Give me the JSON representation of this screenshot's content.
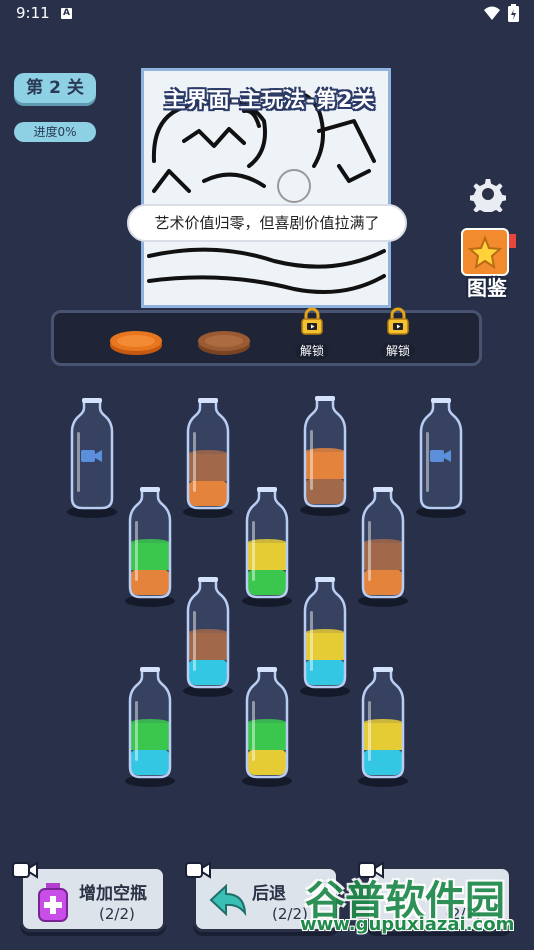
{
  "status_bar": {
    "time": "9:11",
    "notification_icon": "A",
    "icons": [
      "wifi-icon",
      "battery-icon"
    ]
  },
  "level": {
    "label": "第 2 关",
    "progress": "进度0%"
  },
  "picture": {
    "title": "主界面-主玩法-第2关",
    "speech": "艺术价值归零，但喜剧价值拉满了"
  },
  "sidebar": {
    "collection_label": "图鉴"
  },
  "shelf": {
    "slots": [
      {
        "type": "plate",
        "color": "#e8761f"
      },
      {
        "type": "plate",
        "color": "#9a5b32"
      },
      {
        "type": "locked",
        "label": "解锁"
      },
      {
        "type": "locked",
        "label": "解锁"
      }
    ]
  },
  "colors": {
    "orange": "#f07c22",
    "brown": "#a35e32",
    "green": "#2fc936",
    "yellow": "#f2ce19",
    "cyan": "#27c9e0"
  },
  "bottles": [
    {
      "layers": [],
      "video": true
    },
    {
      "layers": [
        "orange",
        "brown"
      ],
      "video": false
    },
    {
      "layers": [
        "brown",
        "orange"
      ],
      "video": false
    },
    {
      "layers": [],
      "video": true
    },
    {
      "layers": [
        "orange",
        "green"
      ],
      "video": false
    },
    {
      "layers": [
        "green",
        "yellow"
      ],
      "video": false
    },
    {
      "layers": [
        "orange",
        "brown"
      ],
      "video": false
    },
    {
      "layers": [
        "cyan",
        "brown"
      ],
      "video": false
    },
    {
      "layers": [
        "cyan",
        "yellow"
      ],
      "video": false
    },
    {
      "layers": [
        "cyan",
        "green"
      ],
      "video": false
    },
    {
      "layers": [
        "yellow",
        "green"
      ],
      "video": false
    },
    {
      "layers": [
        "cyan",
        "yellow"
      ],
      "video": false
    }
  ],
  "buttons": {
    "add_bottle": {
      "label": "增加空瓶",
      "count": "(2/2)"
    },
    "undo": {
      "label": "后退",
      "count": "(2/2)"
    },
    "third": {
      "count": "(2/2)"
    }
  },
  "watermark": {
    "text": "谷普软件园",
    "url": "www.gupuxiazai.com"
  }
}
